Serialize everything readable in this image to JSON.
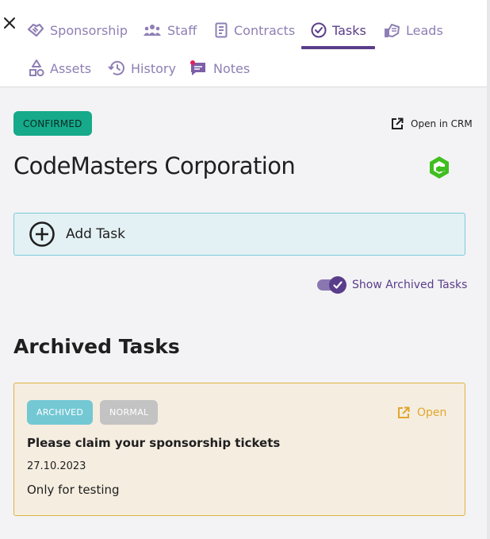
{
  "tabs": [
    {
      "label": "Sponsorship",
      "icon": "handshake-icon",
      "active": false
    },
    {
      "label": "Staff",
      "icon": "people-icon",
      "active": false
    },
    {
      "label": "Contracts",
      "icon": "document-icon",
      "active": false
    },
    {
      "label": "Tasks",
      "icon": "check-circle-icon",
      "active": true
    },
    {
      "label": "Leads",
      "icon": "hand-stack-icon",
      "active": false
    },
    {
      "label": "Assets",
      "icon": "shapes-icon",
      "active": false
    },
    {
      "label": "History",
      "icon": "history-icon",
      "active": false
    },
    {
      "label": "Notes",
      "icon": "chat-note-icon",
      "active": false
    }
  ],
  "header": {
    "status": "CONFIRMED",
    "open_crm": "Open in CRM",
    "company_name": "CodeMasters Corporation",
    "logo_icon": "codemasters-logo-icon"
  },
  "add_task": {
    "label": "Add Task"
  },
  "archived_toggle": {
    "label": "Show Archived Tasks",
    "checked": true
  },
  "section": {
    "title": "Archived Tasks"
  },
  "task": {
    "status_badge": "ARCHIVED",
    "priority_badge": "NORMAL",
    "open_label": "Open",
    "title": "Please claim your sponsorship tickets",
    "date": "27.10.2023",
    "description": "Only for testing"
  },
  "colors": {
    "accent": "#5a3d8a",
    "tab_inactive": "#8e7fb4",
    "confirmed": "#16a98a",
    "archived_badge": "#73c8d4",
    "priority_badge": "#c3c3c3",
    "task_border": "#e0b341"
  }
}
